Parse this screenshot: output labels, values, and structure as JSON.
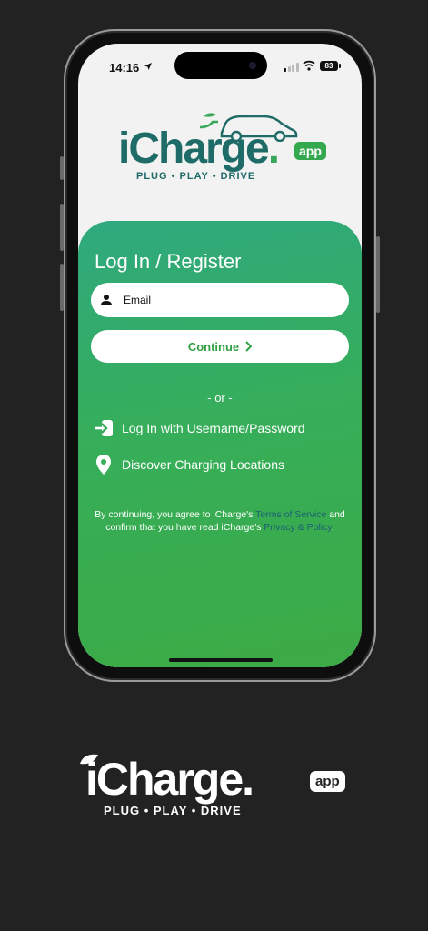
{
  "status_bar": {
    "time": "14:16",
    "battery": "83"
  },
  "logo": {
    "brand_main": "iCharge",
    "brand_dot": ".",
    "badge": "app",
    "tagline": "PLUG • PLAY • DRIVE"
  },
  "login": {
    "title": "Log In / Register",
    "email_placeholder": "Email",
    "continue_label": "Continue",
    "or_text": "- or -",
    "username_login_label": "Log In with Username/Password",
    "discover_label": "Discover Charging Locations"
  },
  "legal": {
    "prefix": "By continuing, you agree to iCharge's ",
    "terms_link": "Terms of Service",
    "middle": " and confirm that you have read iCharge's ",
    "privacy_link": "Privacy & Policy",
    "suffix": "."
  },
  "colors": {
    "brand_teal": "#1e6b67",
    "brand_green": "#3aa85a",
    "panel_start": "#2fa97e",
    "panel_end": "#3caa44",
    "link": "#1d5f74"
  }
}
